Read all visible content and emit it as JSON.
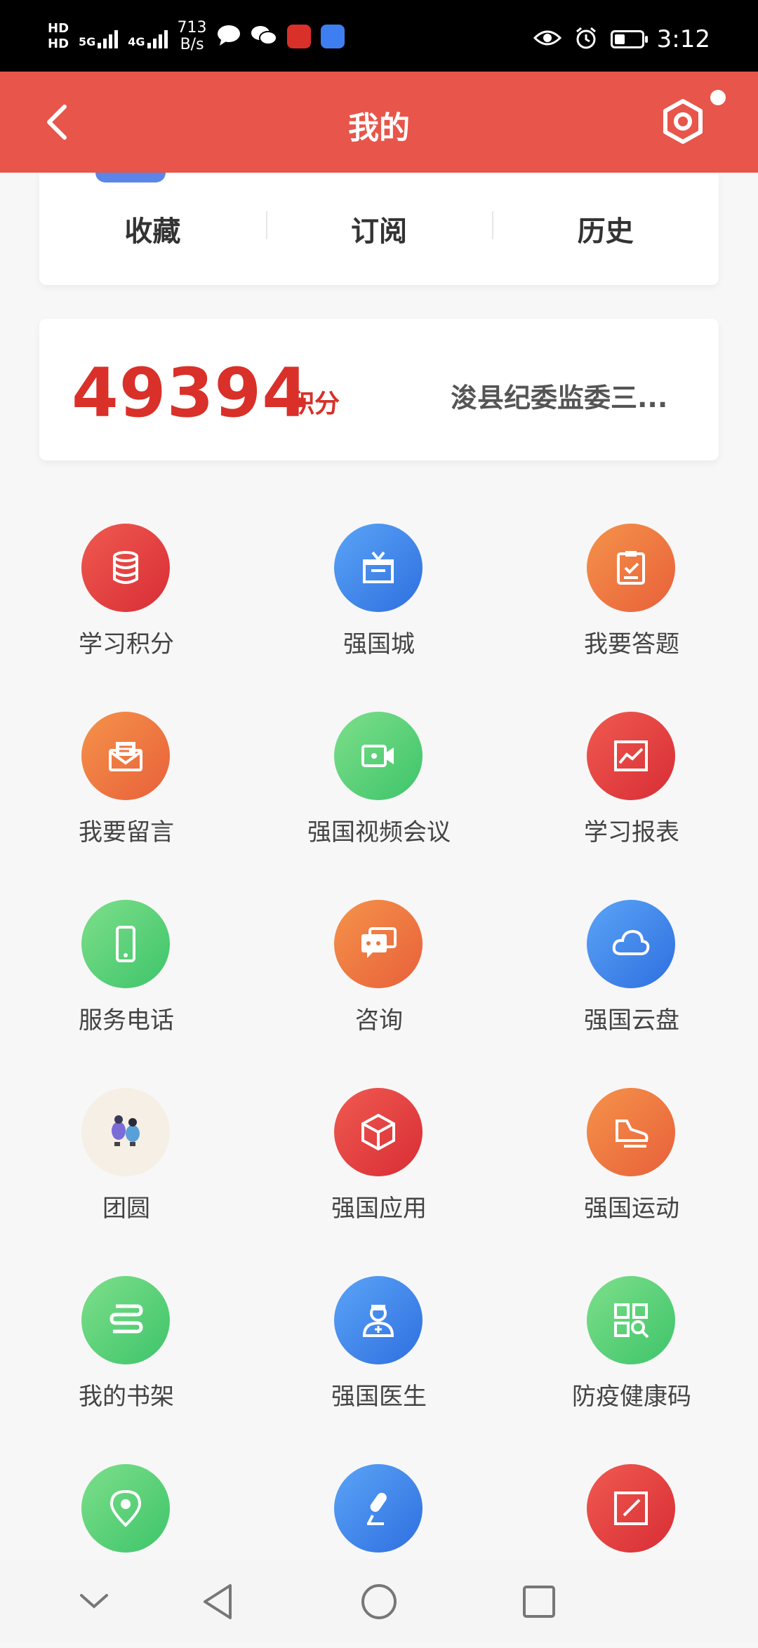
{
  "status_bar": {
    "hd1": "HD",
    "hd2": "HD",
    "net1": "5G",
    "net2": "4G",
    "speed_value": "713",
    "speed_unit": "B/s",
    "time": "3:12",
    "battery_level": 0.4
  },
  "header": {
    "title": "我的"
  },
  "tabs": [
    "收藏",
    "订阅",
    "历史"
  ],
  "points": {
    "value": "49394",
    "unit": "积分",
    "org": "浚县纪委监委三..."
  },
  "grid": [
    {
      "label": "学习积分",
      "icon": "database-icon",
      "color": "#e63d3f"
    },
    {
      "label": "强国城",
      "icon": "gift-icon",
      "color": "#3f83ea"
    },
    {
      "label": "我要答题",
      "icon": "clipboard-check-icon",
      "color": "#ee7540"
    },
    {
      "label": "我要留言",
      "icon": "mail-icon",
      "color": "#ee7540"
    },
    {
      "label": "强国视频会议",
      "icon": "video-camera-icon",
      "color": "#4dcc74"
    },
    {
      "label": "学习报表",
      "icon": "chart-icon",
      "color": "#e63d3f"
    },
    {
      "label": "服务电话",
      "icon": "phone-icon",
      "color": "#4dcc74"
    },
    {
      "label": "咨询",
      "icon": "chat-icon",
      "color": "#ee7540"
    },
    {
      "label": "强国云盘",
      "icon": "cloud-icon",
      "color": "#3f83ea"
    },
    {
      "label": "团圆",
      "icon": "reunion-illustration-icon",
      "color": "#f6efe6"
    },
    {
      "label": "强国应用",
      "icon": "cube-icon",
      "color": "#e63d3f"
    },
    {
      "label": "强国运动",
      "icon": "sneaker-icon",
      "color": "#ee7540"
    },
    {
      "label": "我的书架",
      "icon": "book-icon",
      "color": "#4dcc74"
    },
    {
      "label": "强国医生",
      "icon": "doctor-icon",
      "color": "#3f83ea"
    },
    {
      "label": "防疫健康码",
      "icon": "qr-code-icon",
      "color": "#4dcc74"
    },
    {
      "label": "",
      "icon": "location-pin-icon",
      "color": "#4dcc74"
    },
    {
      "label": "",
      "icon": "microphone-icon",
      "color": "#3f83ea"
    },
    {
      "label": "",
      "icon": "edit-icon",
      "color": "#e63d3f"
    }
  ]
}
